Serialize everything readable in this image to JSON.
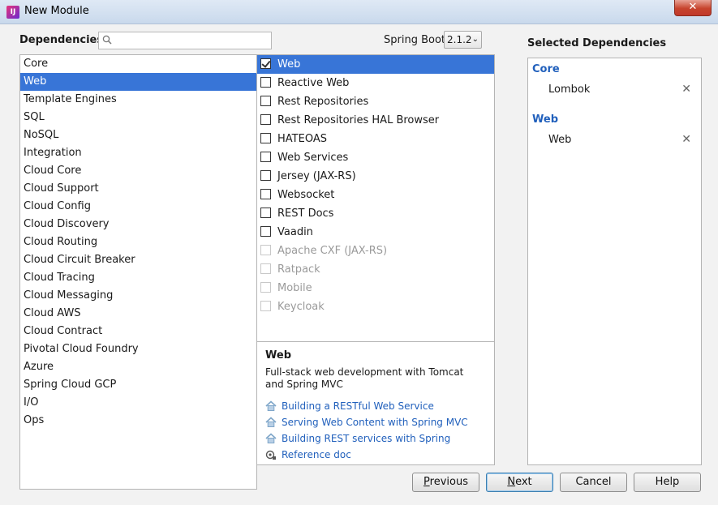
{
  "window": {
    "title": "New Module",
    "close_glyph": "✕"
  },
  "header": {
    "dependencies_label": "Dependencies",
    "search_value": "",
    "search_placeholder": "",
    "spring_boot_label": "Spring Boot",
    "spring_boot_version": "2.1.2"
  },
  "categories": [
    {
      "label": "Core",
      "selected": false
    },
    {
      "label": "Web",
      "selected": true
    },
    {
      "label": "Template Engines",
      "selected": false
    },
    {
      "label": "SQL",
      "selected": false
    },
    {
      "label": "NoSQL",
      "selected": false
    },
    {
      "label": "Integration",
      "selected": false
    },
    {
      "label": "Cloud Core",
      "selected": false
    },
    {
      "label": "Cloud Support",
      "selected": false
    },
    {
      "label": "Cloud Config",
      "selected": false
    },
    {
      "label": "Cloud Discovery",
      "selected": false
    },
    {
      "label": "Cloud Routing",
      "selected": false
    },
    {
      "label": "Cloud Circuit Breaker",
      "selected": false
    },
    {
      "label": "Cloud Tracing",
      "selected": false
    },
    {
      "label": "Cloud Messaging",
      "selected": false
    },
    {
      "label": "Cloud AWS",
      "selected": false
    },
    {
      "label": "Cloud Contract",
      "selected": false
    },
    {
      "label": "Pivotal Cloud Foundry",
      "selected": false
    },
    {
      "label": "Azure",
      "selected": false
    },
    {
      "label": "Spring Cloud GCP",
      "selected": false
    },
    {
      "label": "I/O",
      "selected": false
    },
    {
      "label": "Ops",
      "selected": false
    }
  ],
  "dependencies": [
    {
      "label": "Web",
      "checked": true,
      "selected": true,
      "disabled": false
    },
    {
      "label": "Reactive Web",
      "checked": false,
      "selected": false,
      "disabled": false
    },
    {
      "label": "Rest Repositories",
      "checked": false,
      "selected": false,
      "disabled": false
    },
    {
      "label": "Rest Repositories HAL Browser",
      "checked": false,
      "selected": false,
      "disabled": false
    },
    {
      "label": "HATEOAS",
      "checked": false,
      "selected": false,
      "disabled": false
    },
    {
      "label": "Web Services",
      "checked": false,
      "selected": false,
      "disabled": false
    },
    {
      "label": "Jersey (JAX-RS)",
      "checked": false,
      "selected": false,
      "disabled": false
    },
    {
      "label": "Websocket",
      "checked": false,
      "selected": false,
      "disabled": false
    },
    {
      "label": "REST Docs",
      "checked": false,
      "selected": false,
      "disabled": false
    },
    {
      "label": "Vaadin",
      "checked": false,
      "selected": false,
      "disabled": false
    },
    {
      "label": "Apache CXF (JAX-RS)",
      "checked": false,
      "selected": false,
      "disabled": true
    },
    {
      "label": "Ratpack",
      "checked": false,
      "selected": false,
      "disabled": true
    },
    {
      "label": "Mobile",
      "checked": false,
      "selected": false,
      "disabled": true
    },
    {
      "label": "Keycloak",
      "checked": false,
      "selected": false,
      "disabled": true
    }
  ],
  "description": {
    "title": "Web",
    "text": "Full-stack web development with Tomcat and Spring MVC",
    "links": [
      {
        "label": "Building a RESTful Web Service",
        "icon": "guide-home-icon"
      },
      {
        "label": "Serving Web Content with Spring MVC",
        "icon": "guide-home-icon"
      },
      {
        "label": "Building REST services with Spring",
        "icon": "guide-home-icon"
      },
      {
        "label": "Reference doc",
        "icon": "reference-doc-icon"
      }
    ]
  },
  "selected": {
    "label": "Selected Dependencies",
    "remove_glyph": "✕",
    "groups": [
      {
        "name": "Core",
        "items": [
          "Lombok"
        ]
      },
      {
        "name": "Web",
        "items": [
          "Web"
        ]
      }
    ]
  },
  "buttons": {
    "previous": {
      "pre": "",
      "u": "P",
      "post": "revious"
    },
    "next": {
      "pre": "",
      "u": "N",
      "post": "ext"
    },
    "cancel": "Cancel",
    "help": "Help"
  },
  "colors": {
    "selection": "#3875d7",
    "link": "#2160bc"
  }
}
